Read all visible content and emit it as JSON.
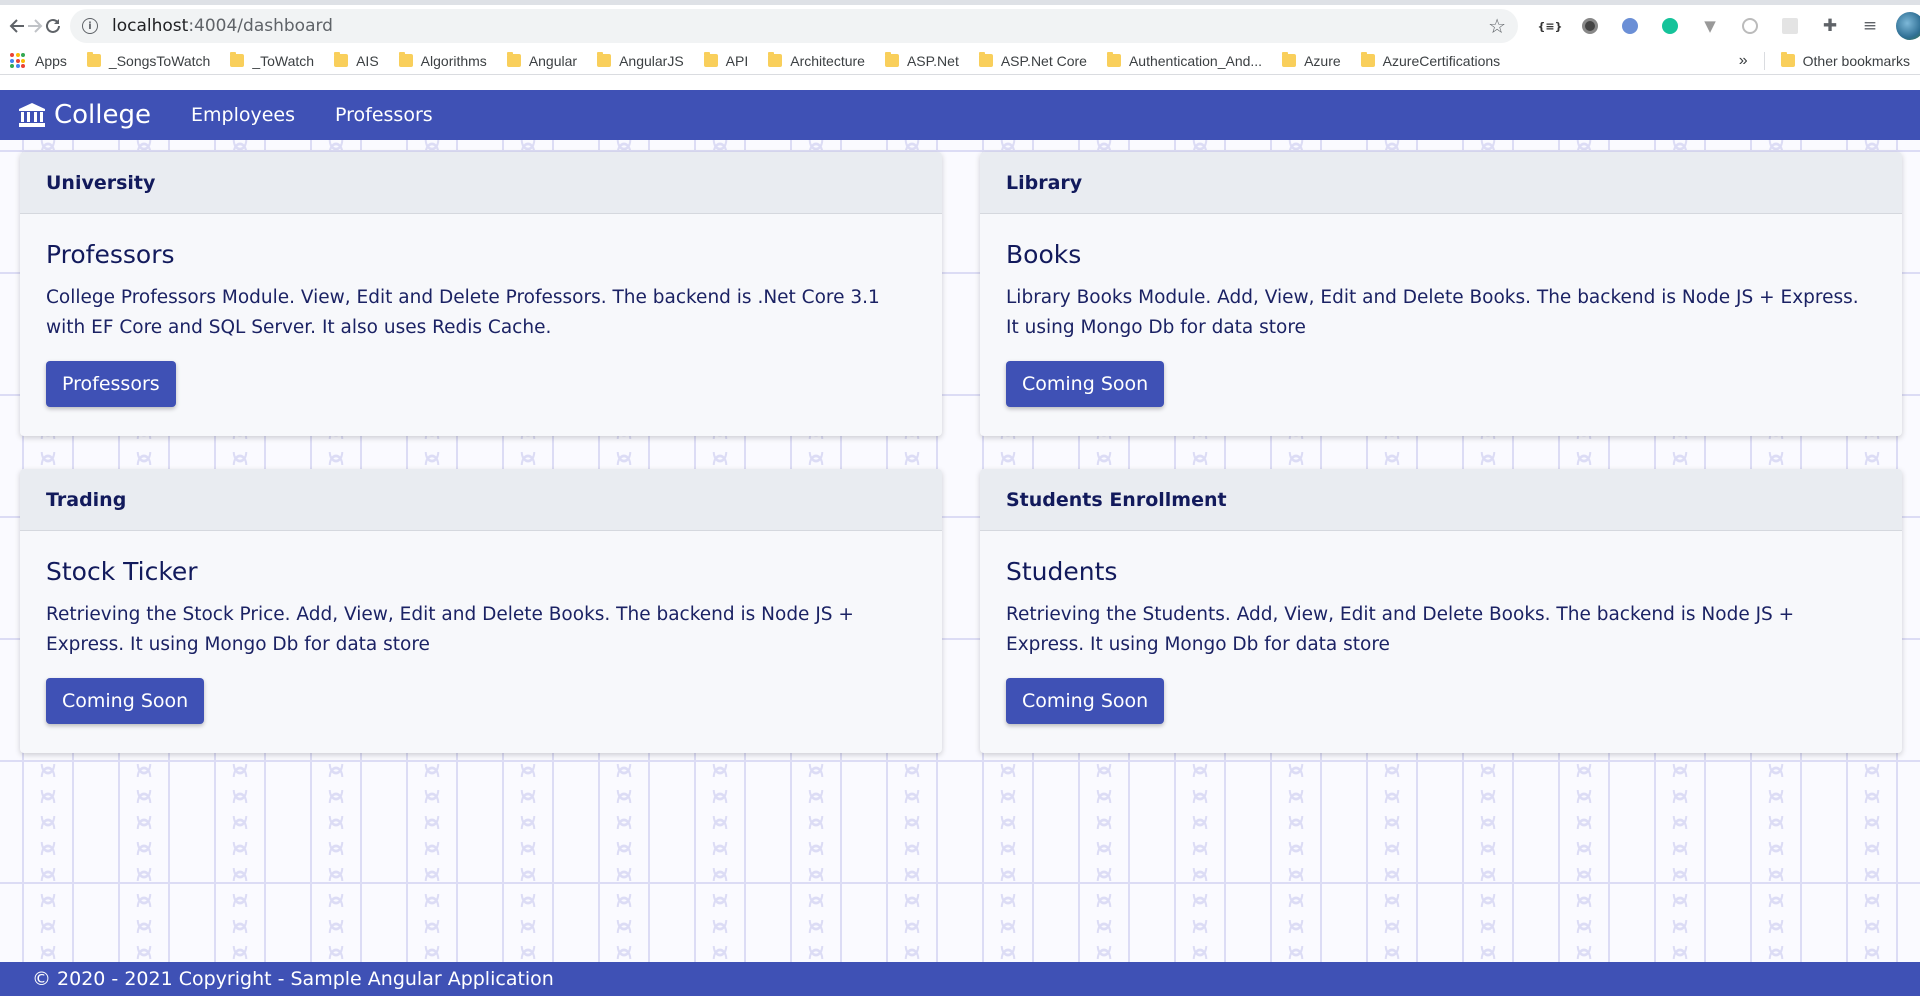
{
  "browser": {
    "url_host": "localhost",
    "url_path": ":4004/dashboard",
    "bookmarks": [
      {
        "label": "Apps",
        "icon": "apps-grid-icon"
      },
      {
        "label": "_SongsToWatch",
        "icon": "folder-icon"
      },
      {
        "label": "_ToWatch",
        "icon": "folder-icon"
      },
      {
        "label": "AIS",
        "icon": "folder-icon"
      },
      {
        "label": "Algorithms",
        "icon": "folder-icon"
      },
      {
        "label": "Angular",
        "icon": "folder-icon"
      },
      {
        "label": "AngularJS",
        "icon": "folder-icon"
      },
      {
        "label": "API",
        "icon": "folder-icon"
      },
      {
        "label": "Architecture",
        "icon": "folder-icon"
      },
      {
        "label": "ASP.Net",
        "icon": "folder-icon"
      },
      {
        "label": "ASP.Net Core",
        "icon": "folder-icon"
      },
      {
        "label": "Authentication_And...",
        "icon": "folder-icon"
      },
      {
        "label": "Azure",
        "icon": "folder-icon"
      },
      {
        "label": "AzureCertifications",
        "icon": "folder-icon"
      }
    ],
    "more_bookmarks": "»",
    "other_bookmarks": "Other bookmarks",
    "ext_json_label": "{≡}"
  },
  "navbar": {
    "brand": "College",
    "links": [
      "Employees",
      "Professors"
    ]
  },
  "cards": [
    {
      "header": "University",
      "title": "Professors",
      "text": "College Professors Module. View, Edit and Delete Professors. The backend is .Net Core 3.1 with EF Core and SQL Server. It also uses Redis Cache.",
      "button": "Professors"
    },
    {
      "header": "Library",
      "title": "Books",
      "text": "Library Books Module. Add, View, Edit and Delete Books. The backend is Node JS + Express. It using Mongo Db for data store",
      "button": "Coming Soon"
    },
    {
      "header": "Trading",
      "title": "Stock Ticker",
      "text": "Retrieving the Stock Price. Add, View, Edit and Delete Books. The backend is Node JS + Express. It using Mongo Db for data store",
      "button": "Coming Soon"
    },
    {
      "header": "Students Enrollment",
      "title": "Students",
      "text": "Retrieving the Students. Add, View, Edit and Delete Books. The backend is Node JS + Express. It using Mongo Db for data store",
      "button": "Coming Soon"
    }
  ],
  "footer": {
    "text": "© 2020 - 2021 Copyright - Sample Angular Application"
  },
  "colors": {
    "primary": "#3f51b5",
    "heading_text": "#121a5c",
    "card_header_bg": "#e9ecf1"
  }
}
